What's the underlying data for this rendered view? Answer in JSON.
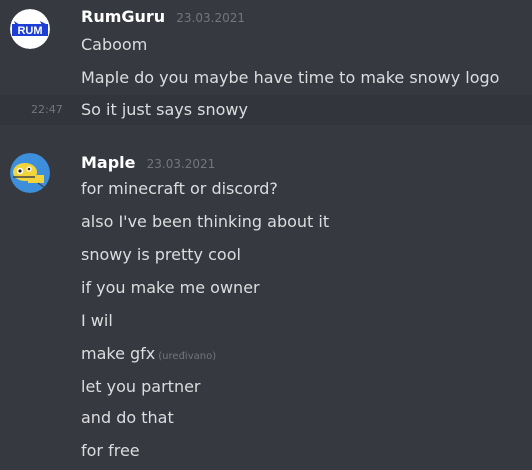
{
  "messages": [
    {
      "author": "RumGuru",
      "timestamp": "23.03.2021",
      "avatar_text": "RUM",
      "lines": [
        {
          "text": "Caboom"
        },
        {
          "text": "Maple do you maybe have time to make snowy logo"
        },
        {
          "text": "So it just says snowy",
          "hover_time": "22:47"
        }
      ]
    },
    {
      "author": "Maple",
      "timestamp": "23.03.2021",
      "lines": [
        {
          "text": "for minecraft or discord?"
        },
        {
          "text": "also I've been thinking about it"
        },
        {
          "text": "snowy is pretty cool"
        },
        {
          "text": "if you make me owner"
        },
        {
          "text": "I wil"
        },
        {
          "text": "make gfx",
          "edited": "(uređivano)"
        },
        {
          "text": "let you partner"
        },
        {
          "text": "and do that"
        },
        {
          "text": "for free"
        }
      ]
    }
  ],
  "colors": {
    "background": "#36393f",
    "hover_background": "#32353b",
    "username": "#ffffff",
    "text": "#dcddde",
    "muted": "#72767d",
    "maple_avatar": "#3d8fdc"
  }
}
